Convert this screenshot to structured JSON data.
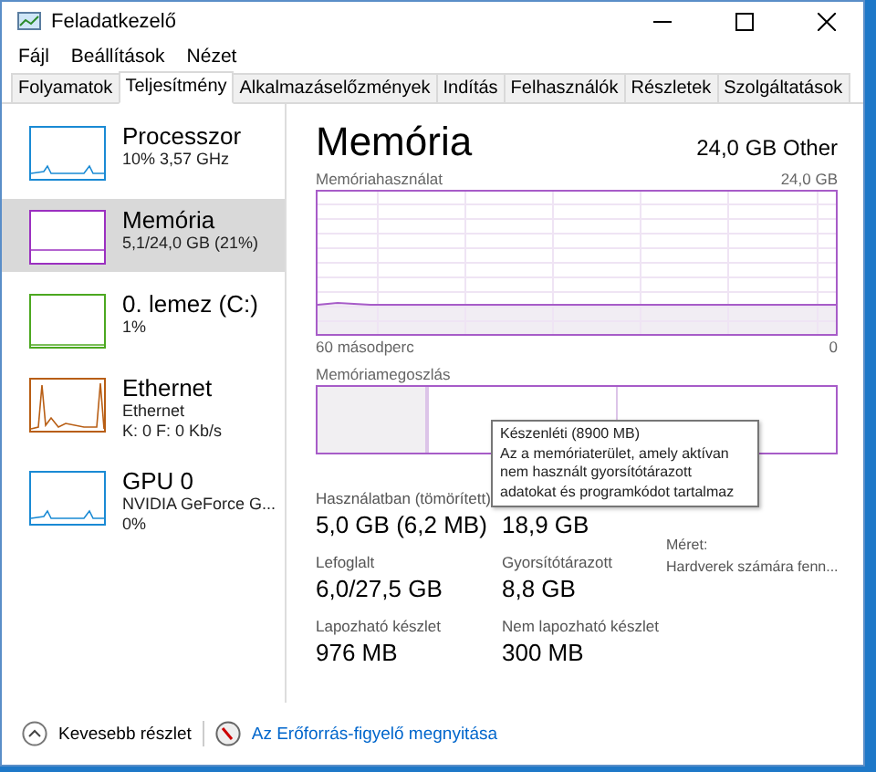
{
  "window": {
    "title": "Feladatkezelő"
  },
  "menu": [
    "Fájl",
    "Beállítások",
    "Nézet"
  ],
  "tabs": [
    {
      "label": "Folyamatok",
      "selected": false
    },
    {
      "label": "Teljesítmény",
      "selected": true
    },
    {
      "label": "Alkalmazáselőzmények",
      "selected": false
    },
    {
      "label": "Indítás",
      "selected": false
    },
    {
      "label": "Felhasználók",
      "selected": false
    },
    {
      "label": "Részletek",
      "selected": false
    },
    {
      "label": "Szolgáltatások",
      "selected": false
    }
  ],
  "sidebar": {
    "items": [
      {
        "name": "Processzor",
        "lines": [
          "10% 3,57 GHz"
        ],
        "color": "#1a8ad4",
        "selected": false
      },
      {
        "name": "Memória",
        "lines": [
          "5,1/24,0 GB (21%)"
        ],
        "color": "#9b30c0",
        "selected": true
      },
      {
        "name": "0. lemez (C:)",
        "lines": [
          "1%"
        ],
        "color": "#4ca820",
        "selected": false
      },
      {
        "name": "Ethernet",
        "lines": [
          "Ethernet",
          "K: 0 F: 0 Kb/s"
        ],
        "color": "#b85e14",
        "selected": false
      },
      {
        "name": "GPU 0",
        "lines": [
          "NVIDIA GeForce G...",
          "0%"
        ],
        "color": "#1a8ad4",
        "selected": false
      }
    ]
  },
  "header": {
    "title": "Memória",
    "capacity": "24,0 GB Other"
  },
  "usage_graph": {
    "label": "Memóriahasználat",
    "max": "24,0 GB",
    "time_span": "60 másodperc",
    "min": "0"
  },
  "composition": {
    "label": "Memóriamegoszlás"
  },
  "tooltip": {
    "title": "Készenléti (8900 MB)",
    "text": "Az a memóriaterület, amely aktívan nem használt gyorsítótárazott adatokat és programkódot tartalmaz"
  },
  "stats": [
    {
      "label": "Használatban (tömörített)",
      "value": "5,0 GB (6,2 MB)"
    },
    {
      "value": "18,9 GB"
    },
    {
      "label": "Lefoglalt",
      "value": "6,0/27,5 GB"
    },
    {
      "label": "Gyorsítótárazott",
      "value": "8,8 GB"
    },
    {
      "label": "Lapozható készlet",
      "value": "976 MB"
    },
    {
      "label": "Nem lapozható készlet",
      "value": "300 MB"
    }
  ],
  "details": [
    "Méret:",
    "Hardverek számára fenn..."
  ],
  "footer": {
    "less_details": "Kevesebb részlet",
    "monitor_link": "Az Erőforrás-figyelő megnyitása"
  }
}
